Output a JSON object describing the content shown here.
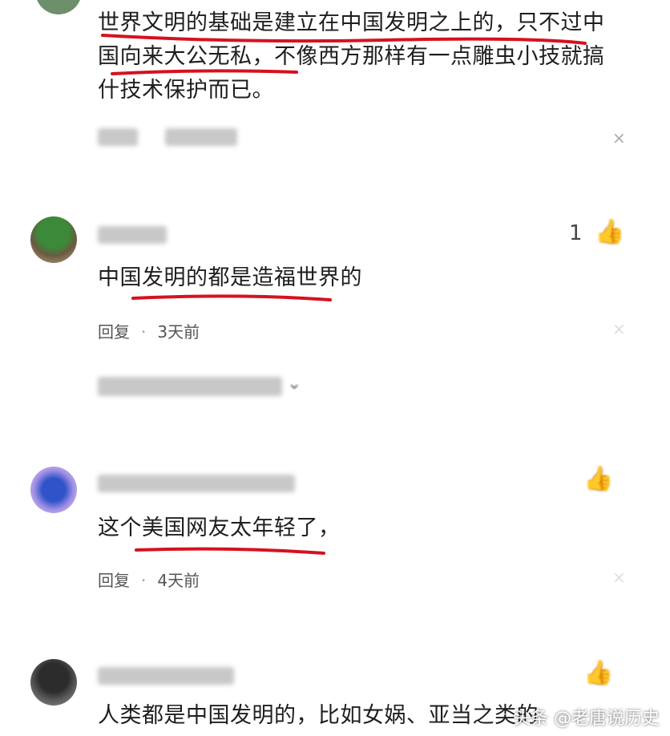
{
  "comments": [
    {
      "text_lines": [
        "世界文明的基础是建立在中国发明之上的，只不过中",
        "国向来大公无私，不像西方那样有一点雕虫小技就搞",
        "什技术保护而已。"
      ]
    },
    {
      "text": "中国发明的都是造福世界的",
      "reply_label": "回复",
      "time": "3天前",
      "like_count": "1"
    },
    {
      "text": "这个美国网友太年轻了，",
      "reply_label": "回复",
      "time": "4天前"
    },
    {
      "text": "人类都是中国发明的，比如女娲、亚当之类的"
    }
  ],
  "watermark": {
    "text": "头条 @老唐说历史"
  },
  "colors": {
    "underline": "#d6111f",
    "text": "#1e1e1e",
    "meta": "#555555"
  }
}
